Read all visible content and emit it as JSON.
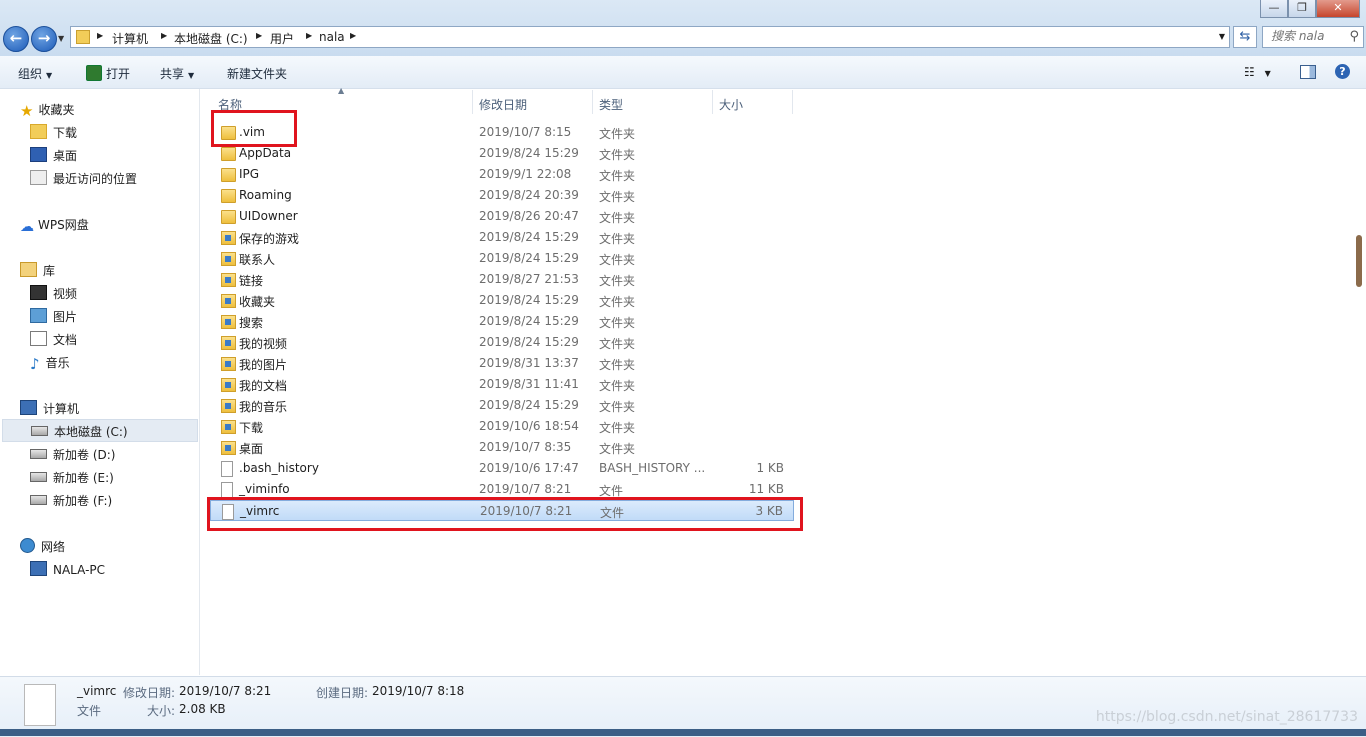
{
  "titlebar": {
    "nav_back_glyph": "←",
    "nav_forward_glyph": "→",
    "breadcrumb": [
      "计算机",
      "本地磁盘 (C:)",
      "用户",
      "nala"
    ],
    "search_placeholder": "搜索 nala",
    "icons": [
      "back-icon",
      "forward-icon",
      "folder-icon",
      "refresh-icon",
      "search-icon",
      "minimize-icon",
      "maximize-icon",
      "close-icon"
    ]
  },
  "toolbar": {
    "organize": "组织",
    "open": "打开",
    "share": "共享",
    "new_folder": "新建文件夹"
  },
  "navpane": {
    "favorites": "收藏夹",
    "favorites_items": [
      "下载",
      "桌面",
      "最近访问的位置"
    ],
    "wps": "WPS网盘",
    "libraries": "库",
    "library_items": [
      "视频",
      "图片",
      "文档",
      "音乐"
    ],
    "computer": "计算机",
    "computer_items": [
      "本地磁盘 (C:)",
      "新加卷 (D:)",
      "新加卷 (E:)",
      "新加卷 (F:)"
    ],
    "selected_drive": "本地磁盘 (C:)",
    "network": "网络",
    "network_items": [
      "NALA-PC"
    ]
  },
  "columns": {
    "name": "名称",
    "modified": "修改日期",
    "type": "类型",
    "size": "大小"
  },
  "files": [
    {
      "name": ".vim",
      "date": "2019/10/7 8:15",
      "type": "文件夹",
      "size": "",
      "icon": "folder"
    },
    {
      "name": "AppData",
      "date": "2019/8/24 15:29",
      "type": "文件夹",
      "size": "",
      "icon": "folder"
    },
    {
      "name": "IPG",
      "date": "2019/9/1 22:08",
      "type": "文件夹",
      "size": "",
      "icon": "folder"
    },
    {
      "name": "Roaming",
      "date": "2019/8/24 20:39",
      "type": "文件夹",
      "size": "",
      "icon": "folder"
    },
    {
      "name": "UIDowner",
      "date": "2019/8/26 20:47",
      "type": "文件夹",
      "size": "",
      "icon": "folder"
    },
    {
      "name": "保存的游戏",
      "date": "2019/8/24 15:29",
      "type": "文件夹",
      "size": "",
      "icon": "special"
    },
    {
      "name": "联系人",
      "date": "2019/8/24 15:29",
      "type": "文件夹",
      "size": "",
      "icon": "special"
    },
    {
      "name": "链接",
      "date": "2019/8/27 21:53",
      "type": "文件夹",
      "size": "",
      "icon": "special"
    },
    {
      "name": "收藏夹",
      "date": "2019/8/24 15:29",
      "type": "文件夹",
      "size": "",
      "icon": "special"
    },
    {
      "name": "搜索",
      "date": "2019/8/24 15:29",
      "type": "文件夹",
      "size": "",
      "icon": "special"
    },
    {
      "name": "我的视频",
      "date": "2019/8/24 15:29",
      "type": "文件夹",
      "size": "",
      "icon": "special"
    },
    {
      "name": "我的图片",
      "date": "2019/8/31 13:37",
      "type": "文件夹",
      "size": "",
      "icon": "special"
    },
    {
      "name": "我的文档",
      "date": "2019/8/31 11:41",
      "type": "文件夹",
      "size": "",
      "icon": "special"
    },
    {
      "name": "我的音乐",
      "date": "2019/8/24 15:29",
      "type": "文件夹",
      "size": "",
      "icon": "special"
    },
    {
      "name": "下载",
      "date": "2019/10/6 18:54",
      "type": "文件夹",
      "size": "",
      "icon": "special"
    },
    {
      "name": "桌面",
      "date": "2019/10/7 8:35",
      "type": "文件夹",
      "size": "",
      "icon": "special"
    },
    {
      "name": ".bash_history",
      "date": "2019/10/6 17:47",
      "type": "BASH_HISTORY ...",
      "size": "1 KB",
      "icon": "file"
    },
    {
      "name": "_viminfo",
      "date": "2019/10/7 8:21",
      "type": "文件",
      "size": "11 KB",
      "icon": "file"
    },
    {
      "name": "_vimrc",
      "date": "2019/10/7 8:21",
      "type": "文件",
      "size": "3 KB",
      "icon": "file",
      "selected": true
    }
  ],
  "details": {
    "name": "_vimrc",
    "modified_label": "修改日期:",
    "modified": "2019/10/7 8:21",
    "created_label": "创建日期:",
    "created": "2019/10/7 8:18",
    "type": "文件",
    "size_label": "大小:",
    "size": "2.08 KB"
  },
  "watermark": "https://blog.csdn.net/sinat_28617733",
  "colors": {
    "highlight_box": "#e0141e",
    "selection": "#c1dbf8"
  }
}
